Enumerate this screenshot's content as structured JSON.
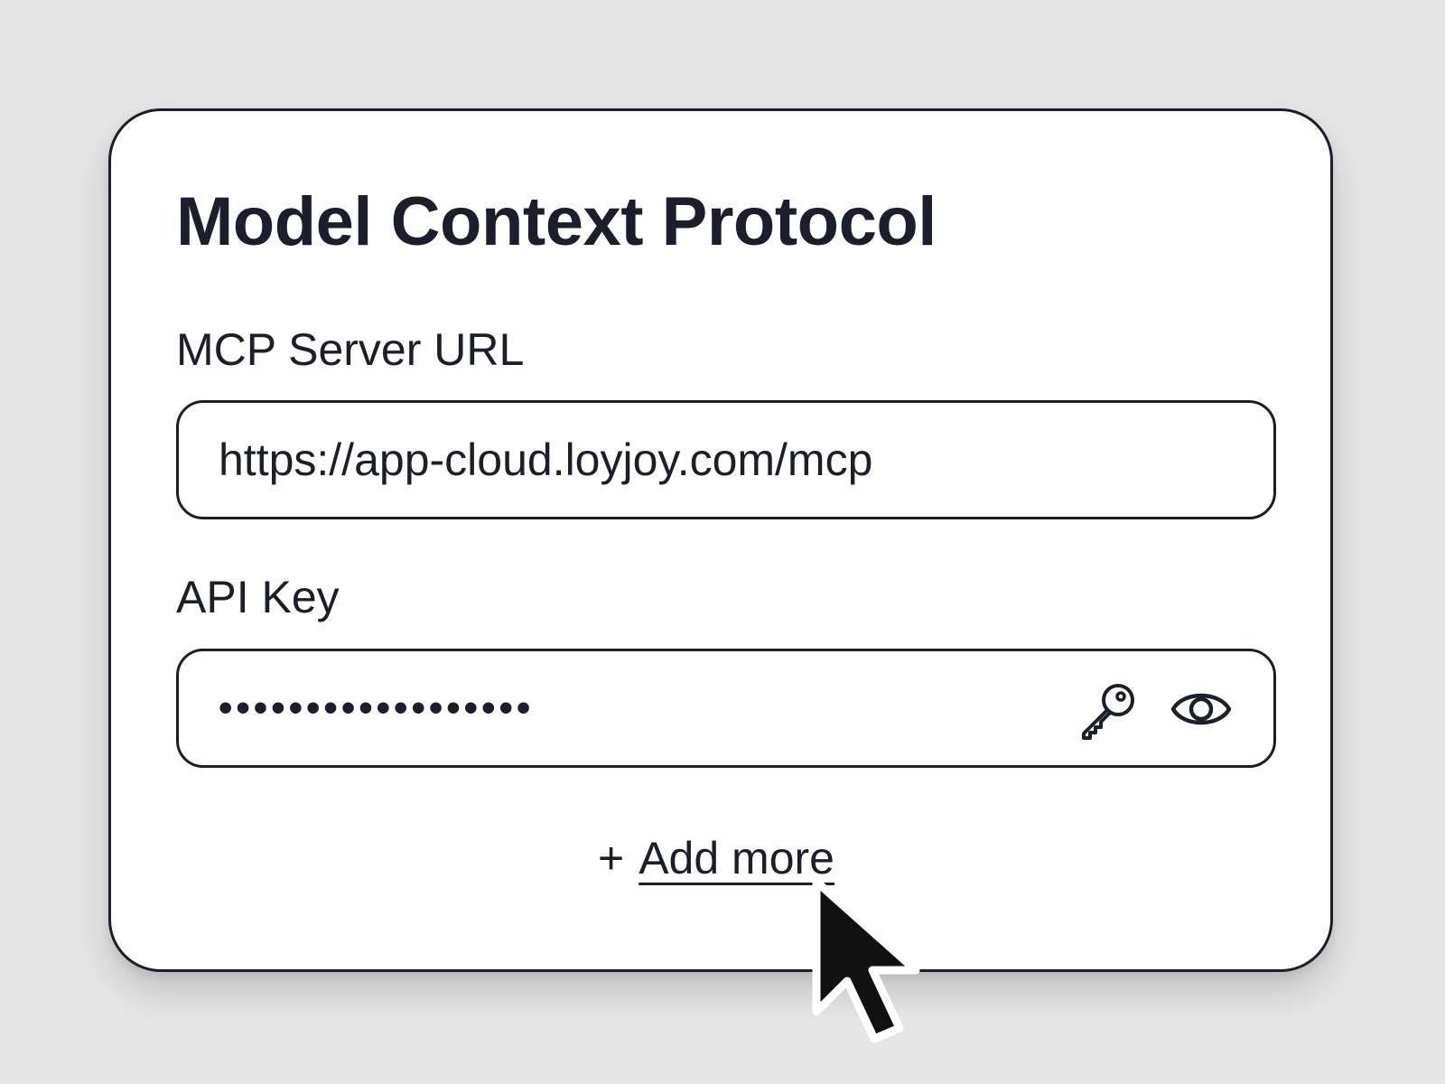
{
  "dialog": {
    "title": "Model Context Protocol"
  },
  "fields": {
    "server_url": {
      "label": "MCP Server URL",
      "value": "https://app-cloud.loyjoy.com/mcp"
    },
    "api_key": {
      "label": "API Key",
      "masked_value": "••••••••••••••••••",
      "icons": [
        "key-icon",
        "eye-icon"
      ]
    }
  },
  "actions": {
    "add_more_prefix": "+",
    "add_more_label": "Add more"
  },
  "colors": {
    "background": "#e6e6e6",
    "card": "#ffffff",
    "ink": "#1c1f2b"
  }
}
